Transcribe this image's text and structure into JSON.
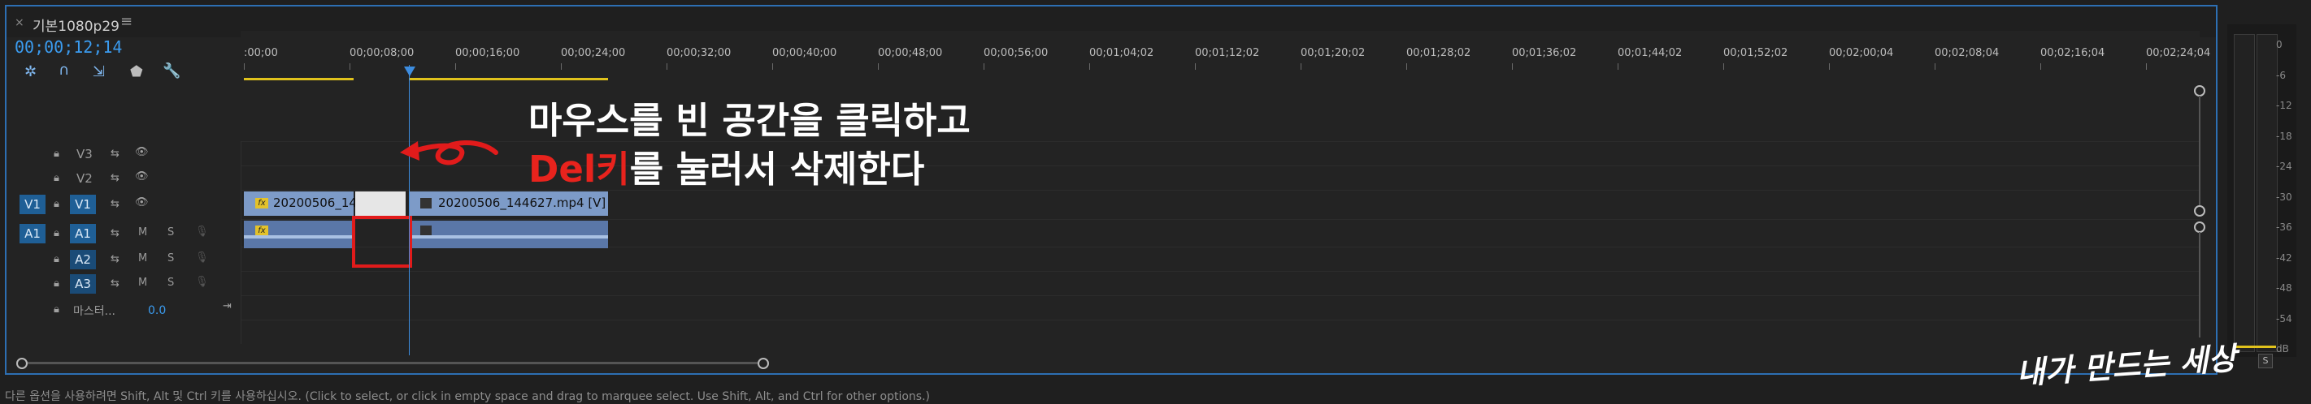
{
  "tab": {
    "close": "×",
    "title": "기본1080p29",
    "menu": "≡"
  },
  "timecode": "00;00;12;14",
  "tools": [
    "snap-icon",
    "linked-selection-icon",
    "marker-add-icon",
    "marker-icon",
    "wrench-icon"
  ],
  "ruler_labels": [
    ":00;00",
    "00;00;08;00",
    "00;00;16;00",
    "00;00;24;00",
    "00;00;32;00",
    "00;00;40;00",
    "00;00;48;00",
    "00;00;56;00",
    "00;01;04;02",
    "00;01;12;02",
    "00;01;20;02",
    "00;01;28;02",
    "00;01;36;02",
    "00;01;44;02",
    "00;01;52;02",
    "00;02;00;04",
    "00;02;08;04",
    "00;02;16;04",
    "00;02;24;04"
  ],
  "tracks": {
    "v3": "V3",
    "v2": "V2",
    "v1_src": "V1",
    "v1": "V1",
    "a1_src": "A1",
    "a1": "A1",
    "a2": "A2",
    "a3": "A3",
    "m": "M",
    "s": "S",
    "master": "마스터...",
    "master_value": "0.0"
  },
  "clips": {
    "v1_left": "20200506_14",
    "v1_right": "20200506_144627.mp4 [V]",
    "fx": "fx"
  },
  "annotation": {
    "line1": "마우스를 빈 공간을 클릭하고",
    "line2_red": "Del키",
    "line2_rest": "를 눌러서 삭제한다"
  },
  "meter": {
    "scale": [
      "0",
      "-6",
      "-12",
      "-18",
      "-24",
      "-30",
      "-36",
      "-42",
      "-48",
      "-54",
      "dB"
    ],
    "solo": "S"
  },
  "status": "다른 옵션을 사용하려면 Shift, Alt 및 Ctrl 키를 사용하십시오. (Click to select, or click in empty space and drag to marquee select. Use Shift, Alt, and Ctrl for other options.)",
  "watermark": "내가 만드는 세상",
  "colors": {
    "accent": "#3b9cf0",
    "annotation_red": "#e8231d",
    "clip_video": "#7d9bc8",
    "clip_audio": "#5a77a8",
    "work_area": "#e0c21c"
  }
}
